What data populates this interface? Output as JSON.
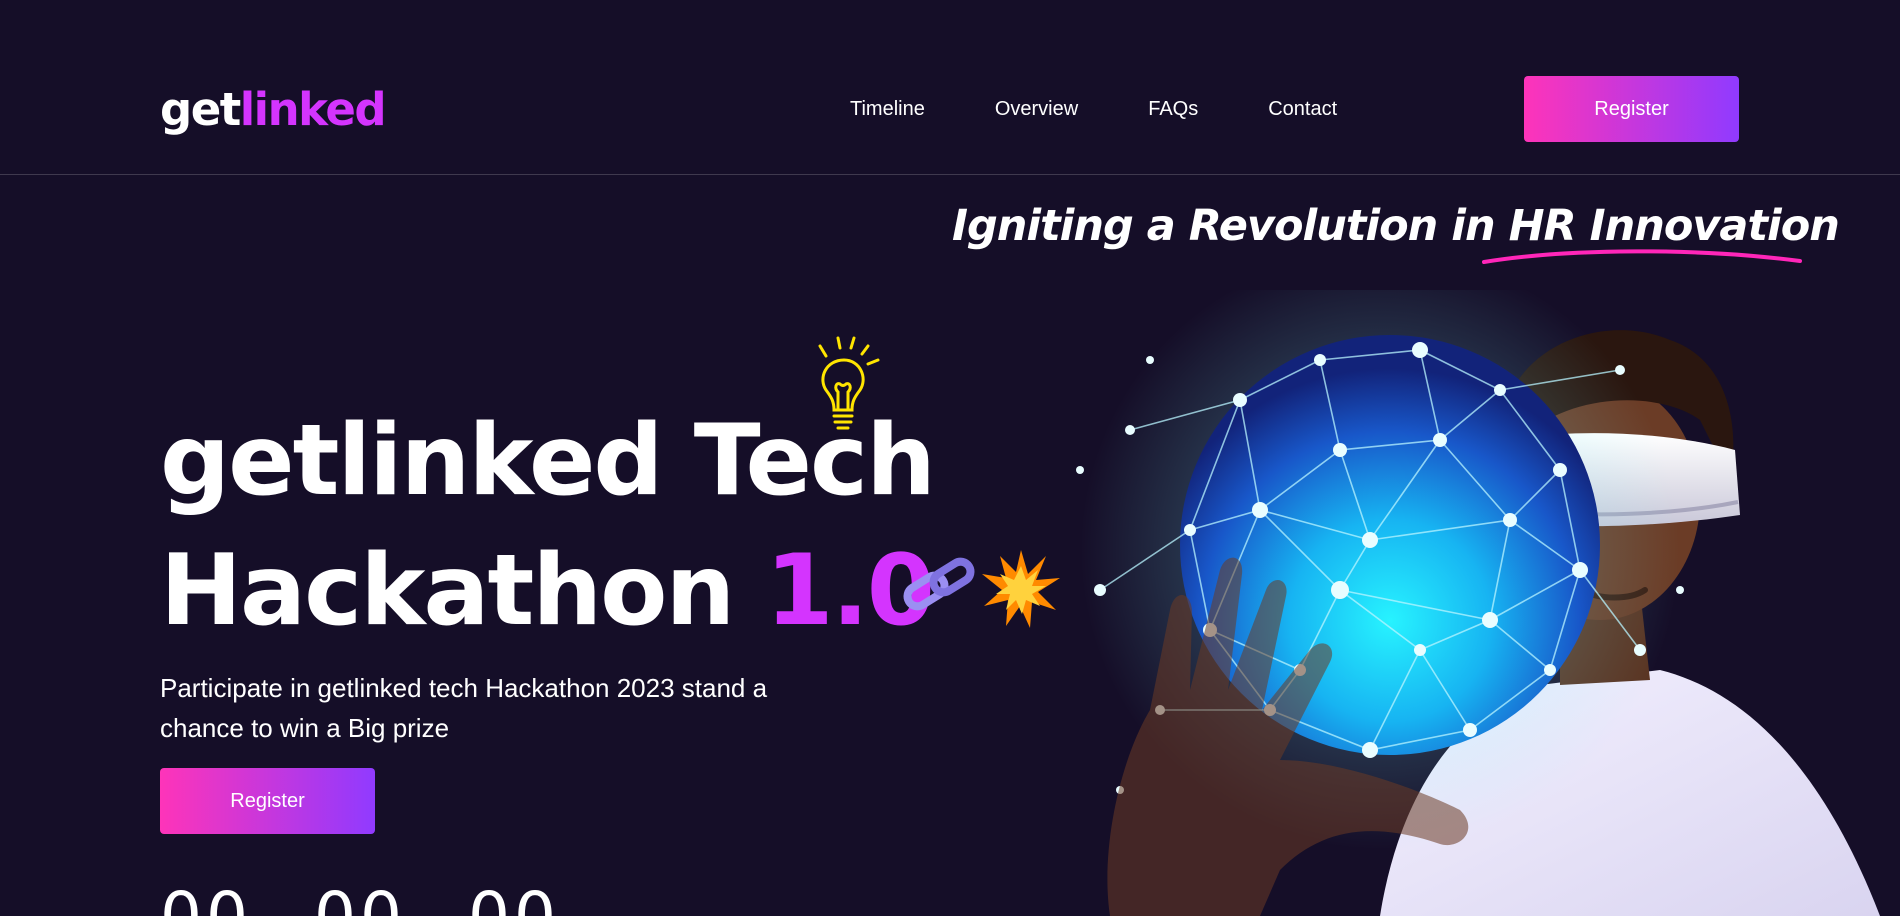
{
  "header": {
    "logo": {
      "part1": "get",
      "part2": "linked"
    },
    "nav": [
      "Timeline",
      "Overview",
      "FAQs",
      "Contact"
    ],
    "register_label": "Register"
  },
  "hero": {
    "tagline": "Igniting a Revolution in HR Innovation",
    "title_line1": "getlinked Tech",
    "title_line2_main": "Hackathon ",
    "title_line2_accent": "1.0",
    "subtitle": "Participate in getlinked tech Hackathon 2023 stand a chance to win a Big prize",
    "register_label": "Register",
    "countdown": [
      "00",
      "00",
      "00"
    ]
  },
  "colors": {
    "background": "#150e28",
    "accent": "#d434fe",
    "button_gradient_start": "#fe34b9",
    "button_gradient_end": "#903aff",
    "underline": "#ff26b9"
  },
  "icons": [
    "bulb-icon",
    "chain-icon",
    "burst-icon"
  ]
}
